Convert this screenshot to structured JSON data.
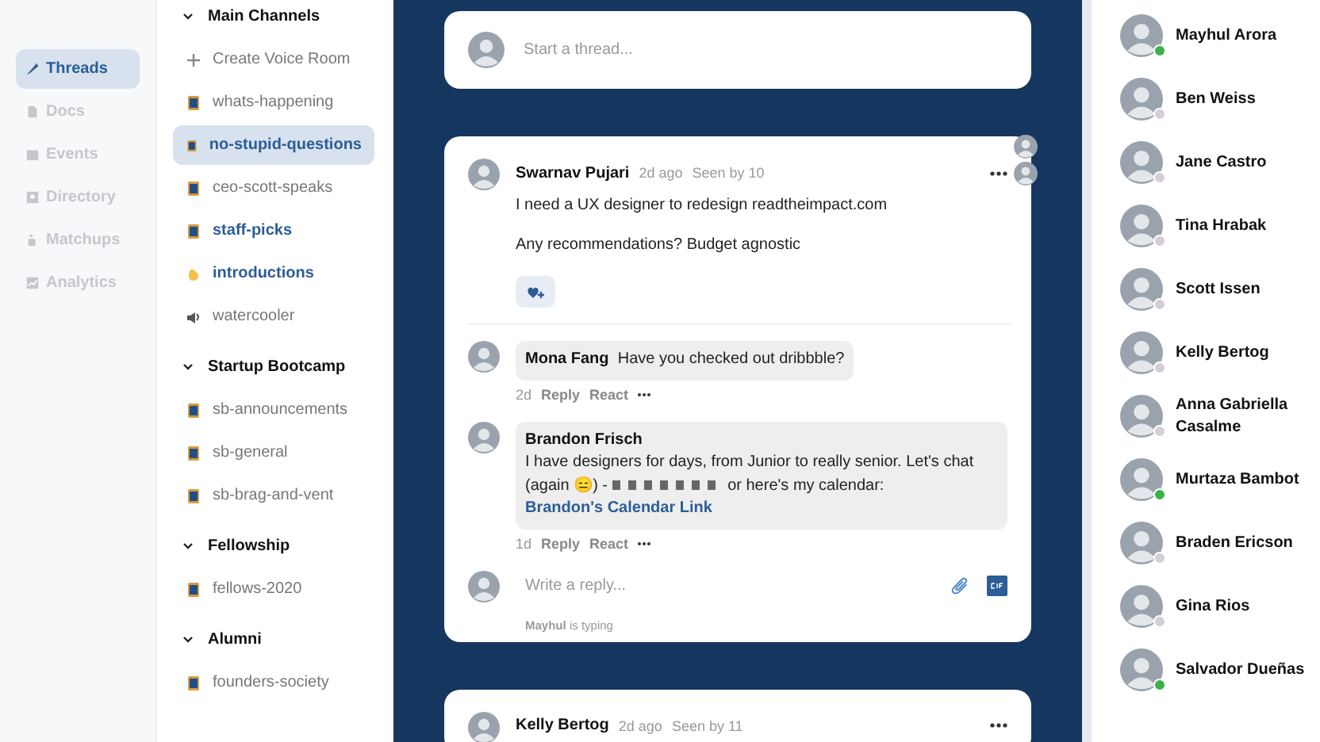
{
  "nav": [
    {
      "label": "Threads",
      "kind": "quill",
      "selected": true
    },
    {
      "label": "Docs",
      "kind": "doc",
      "selected": false
    },
    {
      "label": "Events",
      "kind": "calendar",
      "selected": false
    },
    {
      "label": "Directory",
      "kind": "contact",
      "selected": false
    },
    {
      "label": "Matchups",
      "kind": "cup",
      "selected": false
    },
    {
      "label": "Analytics",
      "kind": "chart",
      "selected": false
    }
  ],
  "channel_groups": [
    {
      "title": "Main Channels",
      "expanded": true,
      "channels": [
        {
          "label": "Create Voice Room",
          "kind": "plus",
          "selected": false,
          "unread": false
        },
        {
          "label": "whats-happening",
          "kind": "spool",
          "selected": false,
          "unread": false
        },
        {
          "label": "no-stupid-questions",
          "kind": "spool",
          "selected": true,
          "unread": true
        },
        {
          "label": "ceo-scott-speaks",
          "kind": "spool",
          "selected": false,
          "unread": false
        },
        {
          "label": "staff-picks",
          "kind": "spool",
          "selected": false,
          "unread": true
        },
        {
          "label": "introductions",
          "kind": "wave",
          "selected": false,
          "unread": true
        },
        {
          "label": "watercooler",
          "kind": "speaker",
          "selected": false,
          "unread": false
        }
      ]
    },
    {
      "title": "Startup Bootcamp",
      "expanded": true,
      "channels": [
        {
          "label": "sb-announcements",
          "kind": "spool",
          "selected": false,
          "unread": false
        },
        {
          "label": "sb-general",
          "kind": "spool",
          "selected": false,
          "unread": false
        },
        {
          "label": "sb-brag-and-vent",
          "kind": "spool",
          "selected": false,
          "unread": false
        }
      ]
    },
    {
      "title": "Fellowship",
      "expanded": true,
      "channels": [
        {
          "label": "fellows-2020",
          "kind": "spool",
          "selected": false,
          "unread": false
        }
      ]
    },
    {
      "title": "Alumni",
      "expanded": true,
      "channels": [
        {
          "label": "founders-society",
          "kind": "spool",
          "selected": false,
          "unread": false
        }
      ]
    }
  ],
  "composer": {
    "placeholder": "Start a thread..."
  },
  "thread": {
    "author": "Swarnav Pujari",
    "time": "2d ago",
    "seen": "Seen by 10",
    "paragraphs": [
      "I need a UX designer to redesign readtheimpact.com",
      "Any recommendations? Budget agnostic"
    ],
    "replies": [
      {
        "author": "Mona Fang",
        "text": "Have you checked out dribbble?",
        "time": "2d",
        "reply": "Reply",
        "react": "React"
      },
      {
        "author": "Brandon Frisch",
        "text": "I have designers for days, from Junior to really senior. Let's chat (again 😑) - ",
        "redacted": true,
        "text_after": " or here's my calendar: ",
        "link": "Brandon's Calendar Link",
        "time": "1d",
        "reply": "Reply",
        "react": "React"
      }
    ],
    "reply_placeholder": "Write a reply...",
    "typing_name": "Mayhul",
    "typing_text": "is typing"
  },
  "next_thread": {
    "author": "Kelly Bertog",
    "time": "2d ago",
    "seen": "Seen by 11"
  },
  "members": [
    {
      "name": "Mayhul Arora",
      "online": true
    },
    {
      "name": "Ben Weiss",
      "online": false
    },
    {
      "name": "Jane Castro",
      "online": false
    },
    {
      "name": "Tina Hrabak",
      "online": false
    },
    {
      "name": "Scott Issen",
      "online": false
    },
    {
      "name": "Kelly Bertog",
      "online": false
    },
    {
      "name": "Anna Gabriella Casalme",
      "online": false
    },
    {
      "name": "Murtaza Bambot",
      "online": true
    },
    {
      "name": "Braden Ericson",
      "online": false
    },
    {
      "name": "Gina Rios",
      "online": false
    },
    {
      "name": "Salvador Dueñas",
      "online": true
    }
  ]
}
